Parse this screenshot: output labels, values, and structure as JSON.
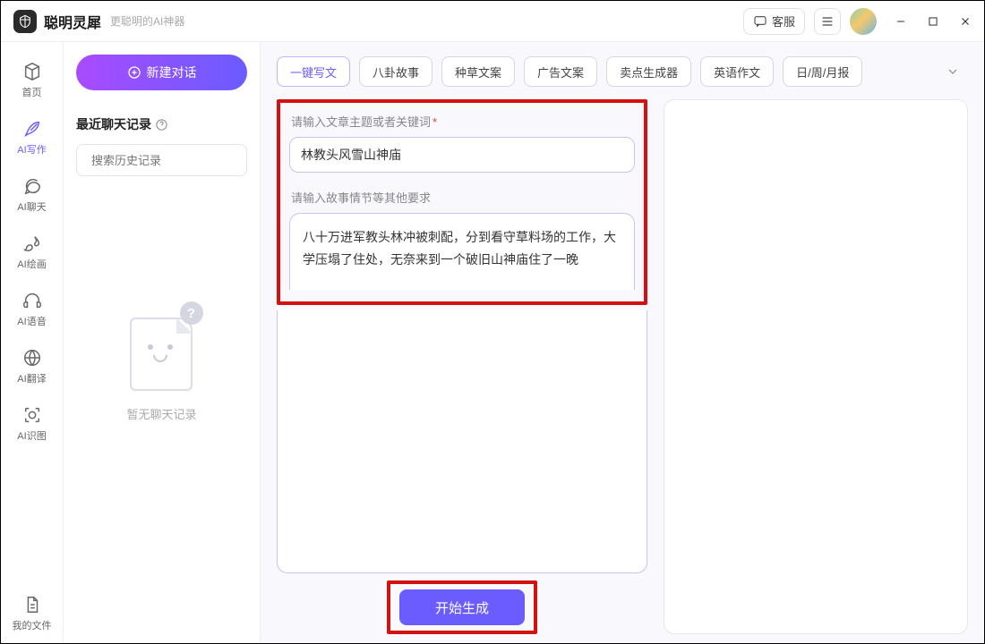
{
  "titlebar": {
    "app_name": "聪明灵犀",
    "tagline": "更聪明的AI神器",
    "kefu_label": "客服"
  },
  "sidebar": {
    "items": [
      {
        "label": "首页"
      },
      {
        "label": "AI写作"
      },
      {
        "label": "AI聊天"
      },
      {
        "label": "AI绘画"
      },
      {
        "label": "AI语音"
      },
      {
        "label": "AI翻译"
      },
      {
        "label": "AI识图"
      }
    ],
    "bottom_item": {
      "label": "我的文件"
    }
  },
  "convo": {
    "new_chat_label": "新建对话",
    "recent_header": "最近聊天记录",
    "search_placeholder": "搜索历史记录",
    "empty_text": "暂无聊天记录",
    "empty_badge": "?"
  },
  "chips": [
    "一键写文",
    "八卦故事",
    "种草文案",
    "广告文案",
    "卖点生成器",
    "英语作文",
    "日/周/月报"
  ],
  "form": {
    "topic_label": "请输入文章主题或者关键词",
    "topic_value": "林教头风雪山神庙",
    "detail_label": "请输入故事情节等其他要求",
    "detail_value": "八十万进军教头林冲被刺配，分到看守草料场的工作，大学压塌了住处，无奈来到一个破旧山神庙住了一晚",
    "generate_label": "开始生成"
  }
}
